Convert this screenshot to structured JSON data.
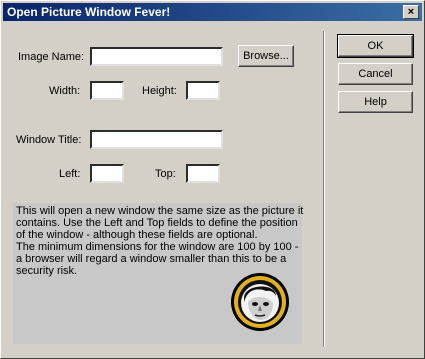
{
  "window": {
    "title": "Open Picture Window Fever!",
    "close_glyph": "×"
  },
  "form": {
    "image_name_label": "Image Name:",
    "image_name_value": "",
    "browse_label": "Browse...",
    "width_label": "Width:",
    "width_value": "",
    "height_label": "Height:",
    "height_value": "",
    "window_title_label": "Window Title:",
    "window_title_value": "",
    "left_label": "Left:",
    "left_value": "",
    "top_label": "Top:",
    "top_value": ""
  },
  "buttons": {
    "ok_label": "OK",
    "cancel_label": "Cancel",
    "help_label": "Help"
  },
  "info": {
    "text": "This will open a new window the same size as the picture it contains. Use the Left and Top fields to define the position of the window - although these fields are optional.\nThe minimum dimensions for the window are 100 by 100 - a browser will regard a window smaller than this to be a security risk."
  },
  "colors": {
    "titlebar": "#0a246a",
    "dialog_bg": "#d4d0c8",
    "info_bg": "#c8c8c8",
    "logo_ring": "#e0b020"
  },
  "icons": {
    "logo": "face-portrait-logo-icon",
    "close": "close-icon"
  }
}
